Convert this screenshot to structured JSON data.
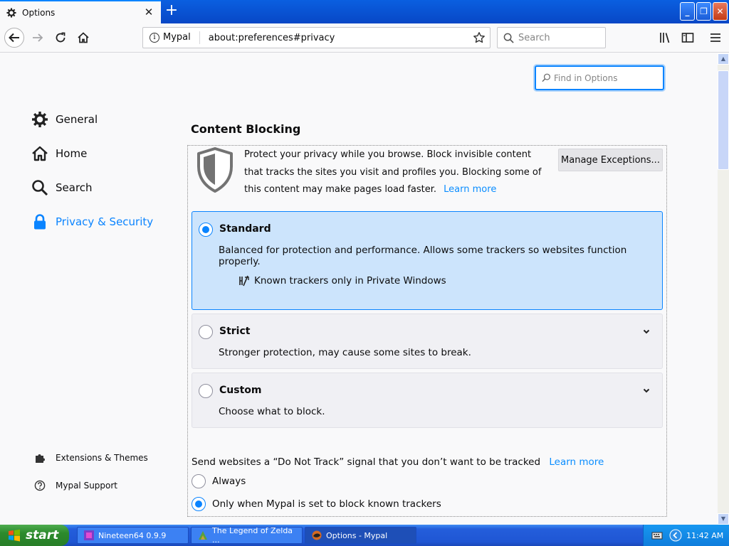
{
  "window": {
    "tab_title": "Options",
    "tab_close": "✕",
    "new_tab": "+",
    "controls": [
      "_",
      "❐",
      "✕"
    ]
  },
  "navbar": {
    "identity_label": "Mypal",
    "url": "about:preferences#privacy",
    "search_placeholder": "Search"
  },
  "find": {
    "placeholder": "Find in Options"
  },
  "sidebar": {
    "categories": [
      {
        "label": "General",
        "icon": "gear-icon"
      },
      {
        "label": "Home",
        "icon": "home-icon"
      },
      {
        "label": "Search",
        "icon": "magnifier-icon"
      },
      {
        "label": "Privacy & Security",
        "icon": "lock-icon",
        "selected": true
      }
    ],
    "footer": [
      {
        "label": "Extensions & Themes",
        "icon": "puzzle-icon"
      },
      {
        "label": "Mypal Support",
        "icon": "help-icon"
      }
    ]
  },
  "content_blocking": {
    "title": "Content Blocking",
    "description": "Protect your privacy while you browse. Block invisible content that tracks the sites you visit and profiles you. Blocking some of this content may make pages load faster.",
    "learn_more": "Learn more",
    "manage_exceptions": "Manage Exceptions...",
    "options": [
      {
        "title": "Standard",
        "description": "Balanced for protection and performance. Allows some trackers so websites function properly.",
        "detail": "Known trackers only in Private Windows",
        "selected": true
      },
      {
        "title": "Strict",
        "description": "Stronger protection, may cause some sites to break.",
        "selected": false
      },
      {
        "title": "Custom",
        "description": "Choose what to block.",
        "selected": false
      }
    ]
  },
  "dnt": {
    "label": "Send websites a “Do Not Track” signal that you don’t want to be tracked",
    "learn_more": "Learn more",
    "options": [
      {
        "label": "Always",
        "selected": false
      },
      {
        "label": "Only when Mypal is set to block known trackers",
        "selected": true
      }
    ]
  },
  "taskbar": {
    "start": "start",
    "items": [
      {
        "label": "Nineteen64 0.9.9",
        "active": false
      },
      {
        "label": "The Legend of Zelda ...",
        "active": false
      },
      {
        "label": "Options - Mypal",
        "active": true
      }
    ],
    "clock": "11:42 AM"
  },
  "colors": {
    "accent": "#0a84ff",
    "selected_option_bg": "#cce4fc",
    "link": "#0a8dff"
  }
}
